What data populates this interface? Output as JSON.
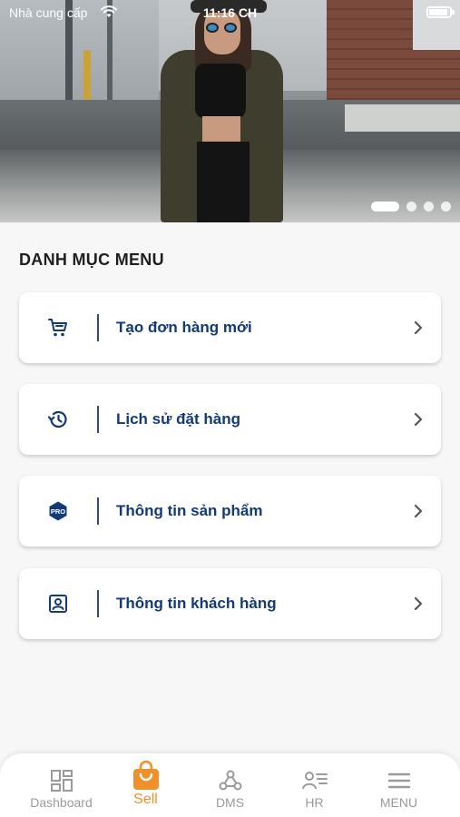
{
  "status_bar": {
    "carrier": "Nhà cung cấp",
    "time": "11:16 CH"
  },
  "banner": {
    "slide_count": 4,
    "active_slide": 1
  },
  "section": {
    "title": "DANH MỤC MENU"
  },
  "menu_items": [
    {
      "label": "Tạo đơn hàng mới",
      "icon": "cart-icon"
    },
    {
      "label": "Lịch sử đặt hàng",
      "icon": "history-icon"
    },
    {
      "label": "Thông tin sản phẩm",
      "icon": "pro-badge-icon"
    },
    {
      "label": "Thông tin khách hàng",
      "icon": "contact-card-icon"
    }
  ],
  "tabs": [
    {
      "label": "Dashboard",
      "icon": "dashboard-icon",
      "active": false
    },
    {
      "label": "Sell",
      "icon": "shopping-bag-icon",
      "active": true
    },
    {
      "label": "DMS",
      "icon": "webhook-icon",
      "active": false
    },
    {
      "label": "HR",
      "icon": "people-list-icon",
      "active": false
    },
    {
      "label": "MENU",
      "icon": "hamburger-menu-icon",
      "active": false
    }
  ],
  "colors": {
    "accent": "#f0902a",
    "primary": "#123a76",
    "background": "#f7f7f7"
  }
}
